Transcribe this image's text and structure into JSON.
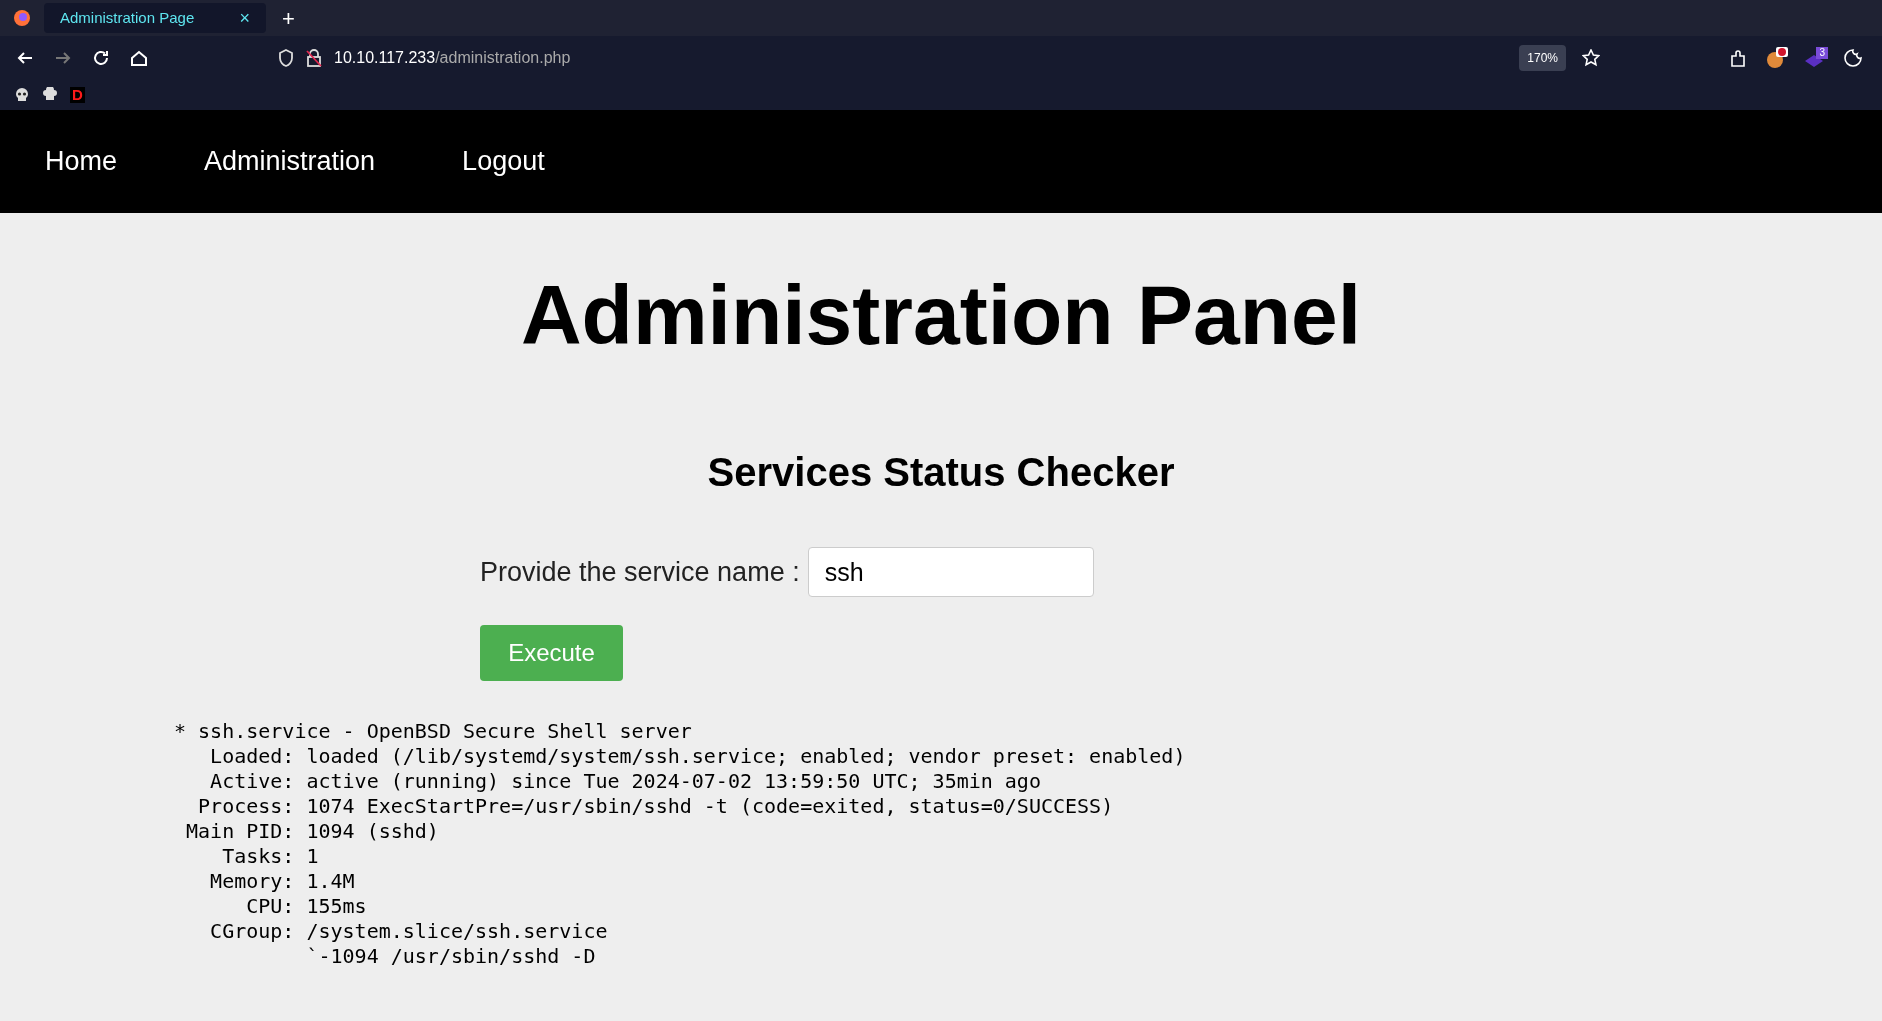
{
  "browser": {
    "tab": {
      "title": "Administration Page",
      "selected": true
    },
    "new_tab": "+",
    "tab_close": "×",
    "url_host": "10.10.117.233",
    "url_path": "/administration.php",
    "zoom": "170%",
    "bookmark_label": "D",
    "extension_badge": "3"
  },
  "nav": {
    "items": [
      {
        "label": "Home"
      },
      {
        "label": "Administration"
      },
      {
        "label": "Logout"
      }
    ]
  },
  "page": {
    "title": "Administration Panel",
    "subtitle": "Services Status Checker",
    "field_label": "Provide the service name :",
    "field_value": "ssh",
    "button": "Execute",
    "output": [
      "* ssh.service - OpenBSD Secure Shell server",
      "   Loaded: loaded (/lib/systemd/system/ssh.service; enabled; vendor preset: enabled)",
      "   Active: active (running) since Tue 2024-07-02 13:59:50 UTC; 35min ago",
      "  Process: 1074 ExecStartPre=/usr/sbin/sshd -t (code=exited, status=0/SUCCESS)",
      " Main PID: 1094 (sshd)",
      "    Tasks: 1",
      "   Memory: 1.4M",
      "      CPU: 155ms",
      "   CGroup: /system.slice/ssh.service",
      "           `-1094 /usr/sbin/sshd -D"
    ]
  }
}
